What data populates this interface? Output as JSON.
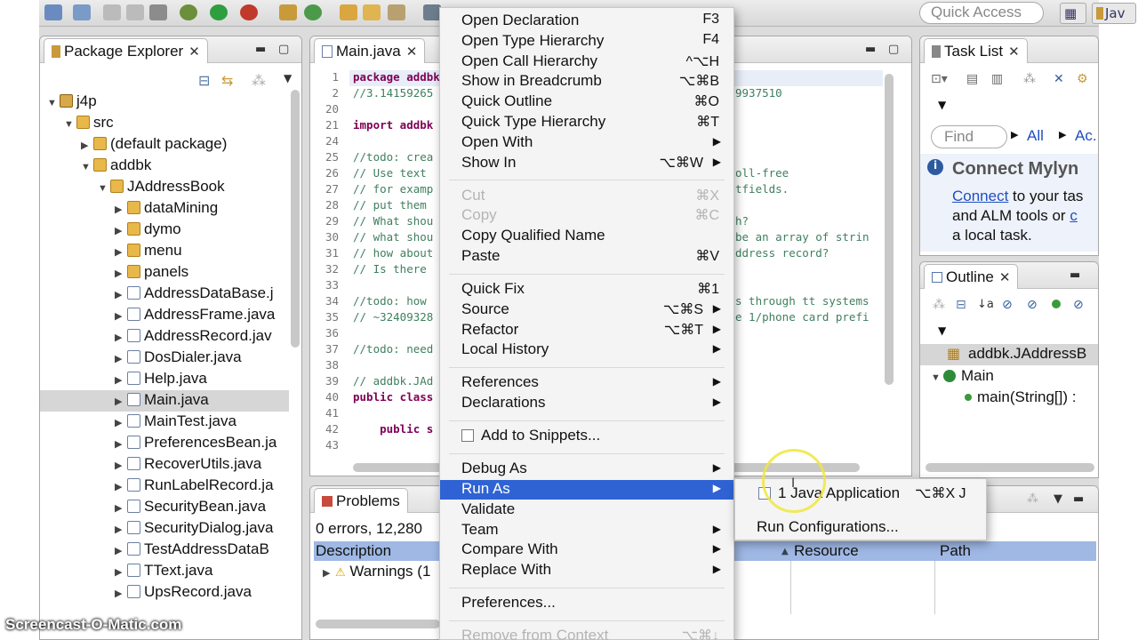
{
  "toolbar": {
    "quick_access_placeholder": "Quick Access",
    "perspective_label": "Jav"
  },
  "package_explorer": {
    "tab_label": "Package Explorer",
    "close_glyph": "✕",
    "tree": [
      {
        "label": "j4p",
        "type": "project",
        "expanded": true,
        "depth": 0
      },
      {
        "label": "src",
        "type": "pkg",
        "expanded": true,
        "depth": 1
      },
      {
        "label": "(default package)",
        "type": "pkg",
        "expanded": false,
        "depth": 2
      },
      {
        "label": "addbk",
        "type": "pkg",
        "expanded": true,
        "depth": 2
      },
      {
        "label": "JAddressBook",
        "type": "pkg",
        "expanded": true,
        "depth": 3
      },
      {
        "label": "dataMining",
        "type": "pkg",
        "expanded": false,
        "depth": 4
      },
      {
        "label": "dymo",
        "type": "pkg",
        "expanded": false,
        "depth": 4
      },
      {
        "label": "menu",
        "type": "pkg",
        "expanded": false,
        "depth": 4
      },
      {
        "label": "panels",
        "type": "pkg",
        "expanded": false,
        "depth": 4
      },
      {
        "label": "AddressDataBase.j",
        "type": "file",
        "expanded": false,
        "depth": 4
      },
      {
        "label": "AddressFrame.java",
        "type": "file",
        "expanded": false,
        "depth": 4
      },
      {
        "label": "AddressRecord.jav",
        "type": "file",
        "expanded": false,
        "depth": 4
      },
      {
        "label": "DosDialer.java",
        "type": "file",
        "expanded": false,
        "depth": 4
      },
      {
        "label": "Help.java",
        "type": "file",
        "expanded": false,
        "depth": 4
      },
      {
        "label": "Main.java",
        "type": "file",
        "expanded": false,
        "depth": 4,
        "selected": true
      },
      {
        "label": "MainTest.java",
        "type": "file",
        "expanded": false,
        "depth": 4
      },
      {
        "label": "PreferencesBean.ja",
        "type": "file",
        "expanded": false,
        "depth": 4
      },
      {
        "label": "RecoverUtils.java",
        "type": "file",
        "expanded": false,
        "depth": 4
      },
      {
        "label": "RunLabelRecord.ja",
        "type": "file",
        "expanded": false,
        "depth": 4
      },
      {
        "label": "SecurityBean.java",
        "type": "file",
        "expanded": false,
        "depth": 4
      },
      {
        "label": "SecurityDialog.java",
        "type": "file",
        "expanded": false,
        "depth": 4
      },
      {
        "label": "TestAddressDataB",
        "type": "file",
        "expanded": false,
        "depth": 4
      },
      {
        "label": "TText.java",
        "type": "file",
        "expanded": false,
        "depth": 4
      },
      {
        "label": "UpsRecord.java",
        "type": "file",
        "expanded": false,
        "depth": 4
      }
    ]
  },
  "editor": {
    "tab_label": "Main.java",
    "lines": [
      {
        "num": "1",
        "text": "package addbk",
        "kind": "kw"
      },
      {
        "num": "2",
        "text": "//3.14159265",
        "kind": "cm",
        "tail": "9937510"
      },
      {
        "num": "20",
        "text": "",
        "kind": ""
      },
      {
        "num": "21",
        "text": "import addbk",
        "kind": "kw"
      },
      {
        "num": "24",
        "text": "",
        "kind": ""
      },
      {
        "num": "25",
        "text": "//todo: crea",
        "kind": "cm"
      },
      {
        "num": "26",
        "text": "// Use text",
        "kind": "cm",
        "tail": "oll-free"
      },
      {
        "num": "27",
        "text": "// for examp",
        "kind": "cm",
        "tail": "tfields."
      },
      {
        "num": "28",
        "text": "// put them",
        "kind": "cm"
      },
      {
        "num": "29",
        "text": "// What shou",
        "kind": "cm",
        "tail": "h?"
      },
      {
        "num": "30",
        "text": "// what shou",
        "kind": "cm",
        "tail": "be an array of strin"
      },
      {
        "num": "31",
        "text": "// how about",
        "kind": "cm",
        "tail": "ddress record?"
      },
      {
        "num": "32",
        "text": "// Is there",
        "kind": "cm"
      },
      {
        "num": "33",
        "text": "",
        "kind": ""
      },
      {
        "num": "34",
        "text": "//todo: how",
        "kind": "cm",
        "tail": "s through tt systems"
      },
      {
        "num": "35",
        "text": "// ~32409328",
        "kind": "cm",
        "tail": "e 1/phone card prefi"
      },
      {
        "num": "36",
        "text": "",
        "kind": ""
      },
      {
        "num": "37",
        "text": "//todo: need",
        "kind": "cm"
      },
      {
        "num": "38",
        "text": "",
        "kind": ""
      },
      {
        "num": "39",
        "text": "// addbk.JAd",
        "kind": "cm"
      },
      {
        "num": "40",
        "text": "public class",
        "kind": "kw"
      },
      {
        "num": "41",
        "text": "",
        "kind": ""
      },
      {
        "num": "42",
        "text": "    public s",
        "kind": "kw"
      },
      {
        "num": "43",
        "text": "",
        "kind": ""
      }
    ]
  },
  "problems": {
    "tab_label": "Problems",
    "summary": "0 errors, 12,280",
    "columns": [
      "Description",
      "Resource",
      "Path"
    ],
    "row": "Warnings (1"
  },
  "task_list": {
    "tab_label": "Task List",
    "find_placeholder": "Find",
    "all_link": "All",
    "ac_link": "Ac.",
    "mylyn_title": "Connect Mylyn",
    "mylyn_connect": "Connect",
    "mylyn_line1_rest": " to your tas",
    "mylyn_line2": "and ALM tools or ",
    "mylyn_line2_link": "c",
    "mylyn_line3": "a local task."
  },
  "outline": {
    "tab_label": "Outline",
    "items": [
      {
        "label": "addbk.JAddressB",
        "kind": "package",
        "selected": true
      },
      {
        "label": "Main",
        "kind": "class"
      },
      {
        "label": "main(String[]) :",
        "kind": "method"
      }
    ]
  },
  "context_menu": {
    "items": [
      {
        "label": "Open Declaration",
        "shortcut": "F3"
      },
      {
        "label": "Open Type Hierarchy",
        "shortcut": "F4"
      },
      {
        "label": "Open Call Hierarchy",
        "shortcut": "^⌥H"
      },
      {
        "label": "Show in Breadcrumb",
        "shortcut": "⌥⌘B"
      },
      {
        "label": "Quick Outline",
        "shortcut": "⌘O"
      },
      {
        "label": "Quick Type Hierarchy",
        "shortcut": "⌘T"
      },
      {
        "label": "Open With",
        "submenu": true
      },
      {
        "label": "Show In",
        "shortcut": "⌥⌘W",
        "submenu": true
      },
      {
        "separator": true
      },
      {
        "label": "Cut",
        "shortcut": "⌘X",
        "disabled": true
      },
      {
        "label": "Copy",
        "shortcut": "⌘C",
        "disabled": true
      },
      {
        "label": "Copy Qualified Name"
      },
      {
        "label": "Paste",
        "shortcut": "⌘V"
      },
      {
        "separator": true
      },
      {
        "label": "Quick Fix",
        "shortcut": "⌘1"
      },
      {
        "label": "Source",
        "shortcut": "⌥⌘S",
        "submenu": true
      },
      {
        "label": "Refactor",
        "shortcut": "⌥⌘T",
        "submenu": true
      },
      {
        "label": "Local History",
        "submenu": true
      },
      {
        "separator": true
      },
      {
        "label": "References",
        "submenu": true
      },
      {
        "label": "Declarations",
        "submenu": true
      },
      {
        "separator": true
      },
      {
        "label": "Add to Snippets...",
        "icon": true
      },
      {
        "separator": true
      },
      {
        "label": "Debug As",
        "submenu": true
      },
      {
        "label": "Run As",
        "submenu": true,
        "highlighted": true
      },
      {
        "label": "Validate"
      },
      {
        "label": "Team",
        "submenu": true
      },
      {
        "label": "Compare With",
        "submenu": true
      },
      {
        "label": "Replace With",
        "submenu": true
      },
      {
        "separator": true
      },
      {
        "label": "Preferences..."
      },
      {
        "separator": true
      },
      {
        "label": "Remove from Context",
        "shortcut": "⌥⌘↓",
        "disabled": true
      }
    ]
  },
  "run_as_submenu": {
    "items": [
      {
        "label": "1 Java Application",
        "shortcut": "⌥⌘X J"
      },
      {
        "label": "Run Configurations..."
      }
    ]
  },
  "watermark": "Screencast-O-Matic.com",
  "colors": {
    "menu_highlight": "#2f63d4",
    "link": "#1f4fbf",
    "code_keyword": "#7f0055",
    "code_comment": "#3f7f5f"
  }
}
